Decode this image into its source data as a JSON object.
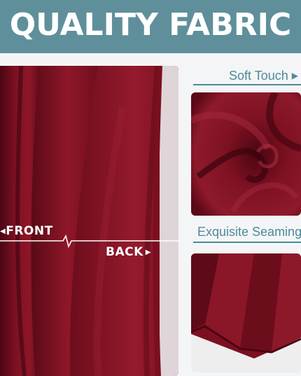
{
  "banner": {
    "title": "QUALITY FABRIC",
    "color": "#5f8f9b"
  },
  "fabric_color": "#7a0f1f",
  "left_panel": {
    "front_label": "FRONT",
    "back_label": "BACK",
    "front_arrow": "◀",
    "back_arrow": "▶"
  },
  "detail_1": {
    "caption": "Soft Touch",
    "arrow": "▶"
  },
  "detail_2": {
    "caption": "Exquisite Seaming"
  }
}
